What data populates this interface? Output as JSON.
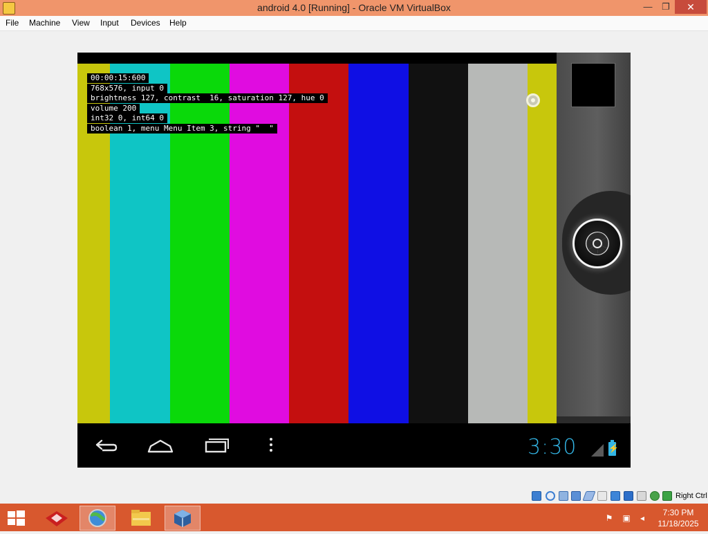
{
  "window": {
    "title": "android 4.0 [Running] - Oracle VM VirtualBox",
    "minimize_glyph": "—",
    "maximize_glyph": "❐",
    "close_glyph": "✕"
  },
  "menu": {
    "items": [
      "File",
      "Machine",
      "View",
      "Input",
      "Devices",
      "Help"
    ]
  },
  "osd": {
    "lines": [
      "00:00:15:600",
      "768x576, input 0",
      "brightness 127, contrast  16, saturation 127, hue 0",
      "volume 200",
      "int32 0, int64 0",
      "boolean 1, menu Menu Item 3, string \"  \""
    ]
  },
  "color_bars": [
    "#c8c70c",
    "#0fc5c5",
    "#0ad90a",
    "#e00ce0",
    "#c40f0f",
    "#0f0fe4",
    "#111111",
    "#b7b9b7",
    "#c8c70c"
  ],
  "navbar": {
    "clock": "3:30",
    "battery_glyph": "⚡"
  },
  "statusbar": {
    "host_key": "Right Ctrl"
  },
  "taskbar": {
    "time": "7:30 PM",
    "date": "11/18/2025"
  },
  "colors": {
    "title_bar": "#f0956b",
    "taskbar": "#d8582e",
    "android_accent": "#33b5e5",
    "close_button": "#c74b3c"
  }
}
